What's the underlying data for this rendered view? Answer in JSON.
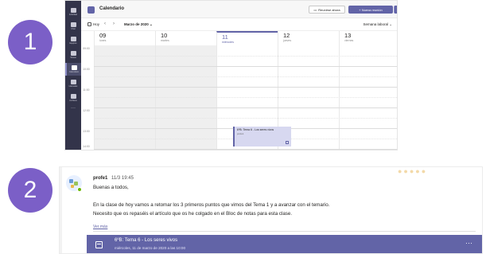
{
  "steps": [
    "1",
    "2"
  ],
  "sidebar": {
    "items": [
      {
        "label": "Actividad",
        "icon": "bell-icon",
        "active": false
      },
      {
        "label": "Chat",
        "icon": "chat-icon",
        "active": false
      },
      {
        "label": "Equipos",
        "icon": "teams-icon",
        "active": false
      },
      {
        "label": "Tareas",
        "icon": "assignments-icon",
        "active": false
      },
      {
        "label": "Calendario",
        "icon": "calendar-icon",
        "active": true
      },
      {
        "label": "Llamadas",
        "icon": "phone-icon",
        "active": false
      },
      {
        "label": "Archivos",
        "icon": "files-icon",
        "active": false
      }
    ],
    "more": "···"
  },
  "calendar": {
    "title": "Calendario",
    "meet_now": "Reunirse ahora",
    "new_meeting": "+ Nueva reunión",
    "dropdown_arrow": "⌄",
    "today": "Hoy",
    "prev": "‹",
    "next": "›",
    "month": "Marzo de 2020 ⌄",
    "view": "Semana laboral ⌄",
    "days": [
      {
        "num": "09",
        "name": "lunes"
      },
      {
        "num": "10",
        "name": "martes"
      },
      {
        "num": "11",
        "name": "miércoles"
      },
      {
        "num": "12",
        "name": "jueves"
      },
      {
        "num": "13",
        "name": "viernes"
      }
    ],
    "times": [
      "09:00",
      "10:00",
      "11:00",
      "12:00",
      "13:00",
      "14:00"
    ],
    "event": {
      "title": "6ºB: Tema 6 - Los seres vivos",
      "organizer": "profe1"
    }
  },
  "post": {
    "author": "profe1",
    "timestamp": "11/3 19:45",
    "lines": [
      "Buenas a todos,",
      "En la clase de hoy vamos a retomar los 3 primeros puntos que vimos del Tema 1 y a avanzar con el temario.",
      "Necesito que os repaséis el artículo que os he colgado en el Bloc de notas para esta clase."
    ],
    "see_more": "Ver más",
    "meeting": {
      "title": "6ºB: Tema 6 - Los seres vivos",
      "date": "miércoles, 11 de marzo de 2020 a las 10:00",
      "more": "···"
    }
  },
  "colors": {
    "accent": "#6264a7",
    "step_circle": "#7b5fc7",
    "rail": "#33344a",
    "presence": "#6bb700"
  }
}
